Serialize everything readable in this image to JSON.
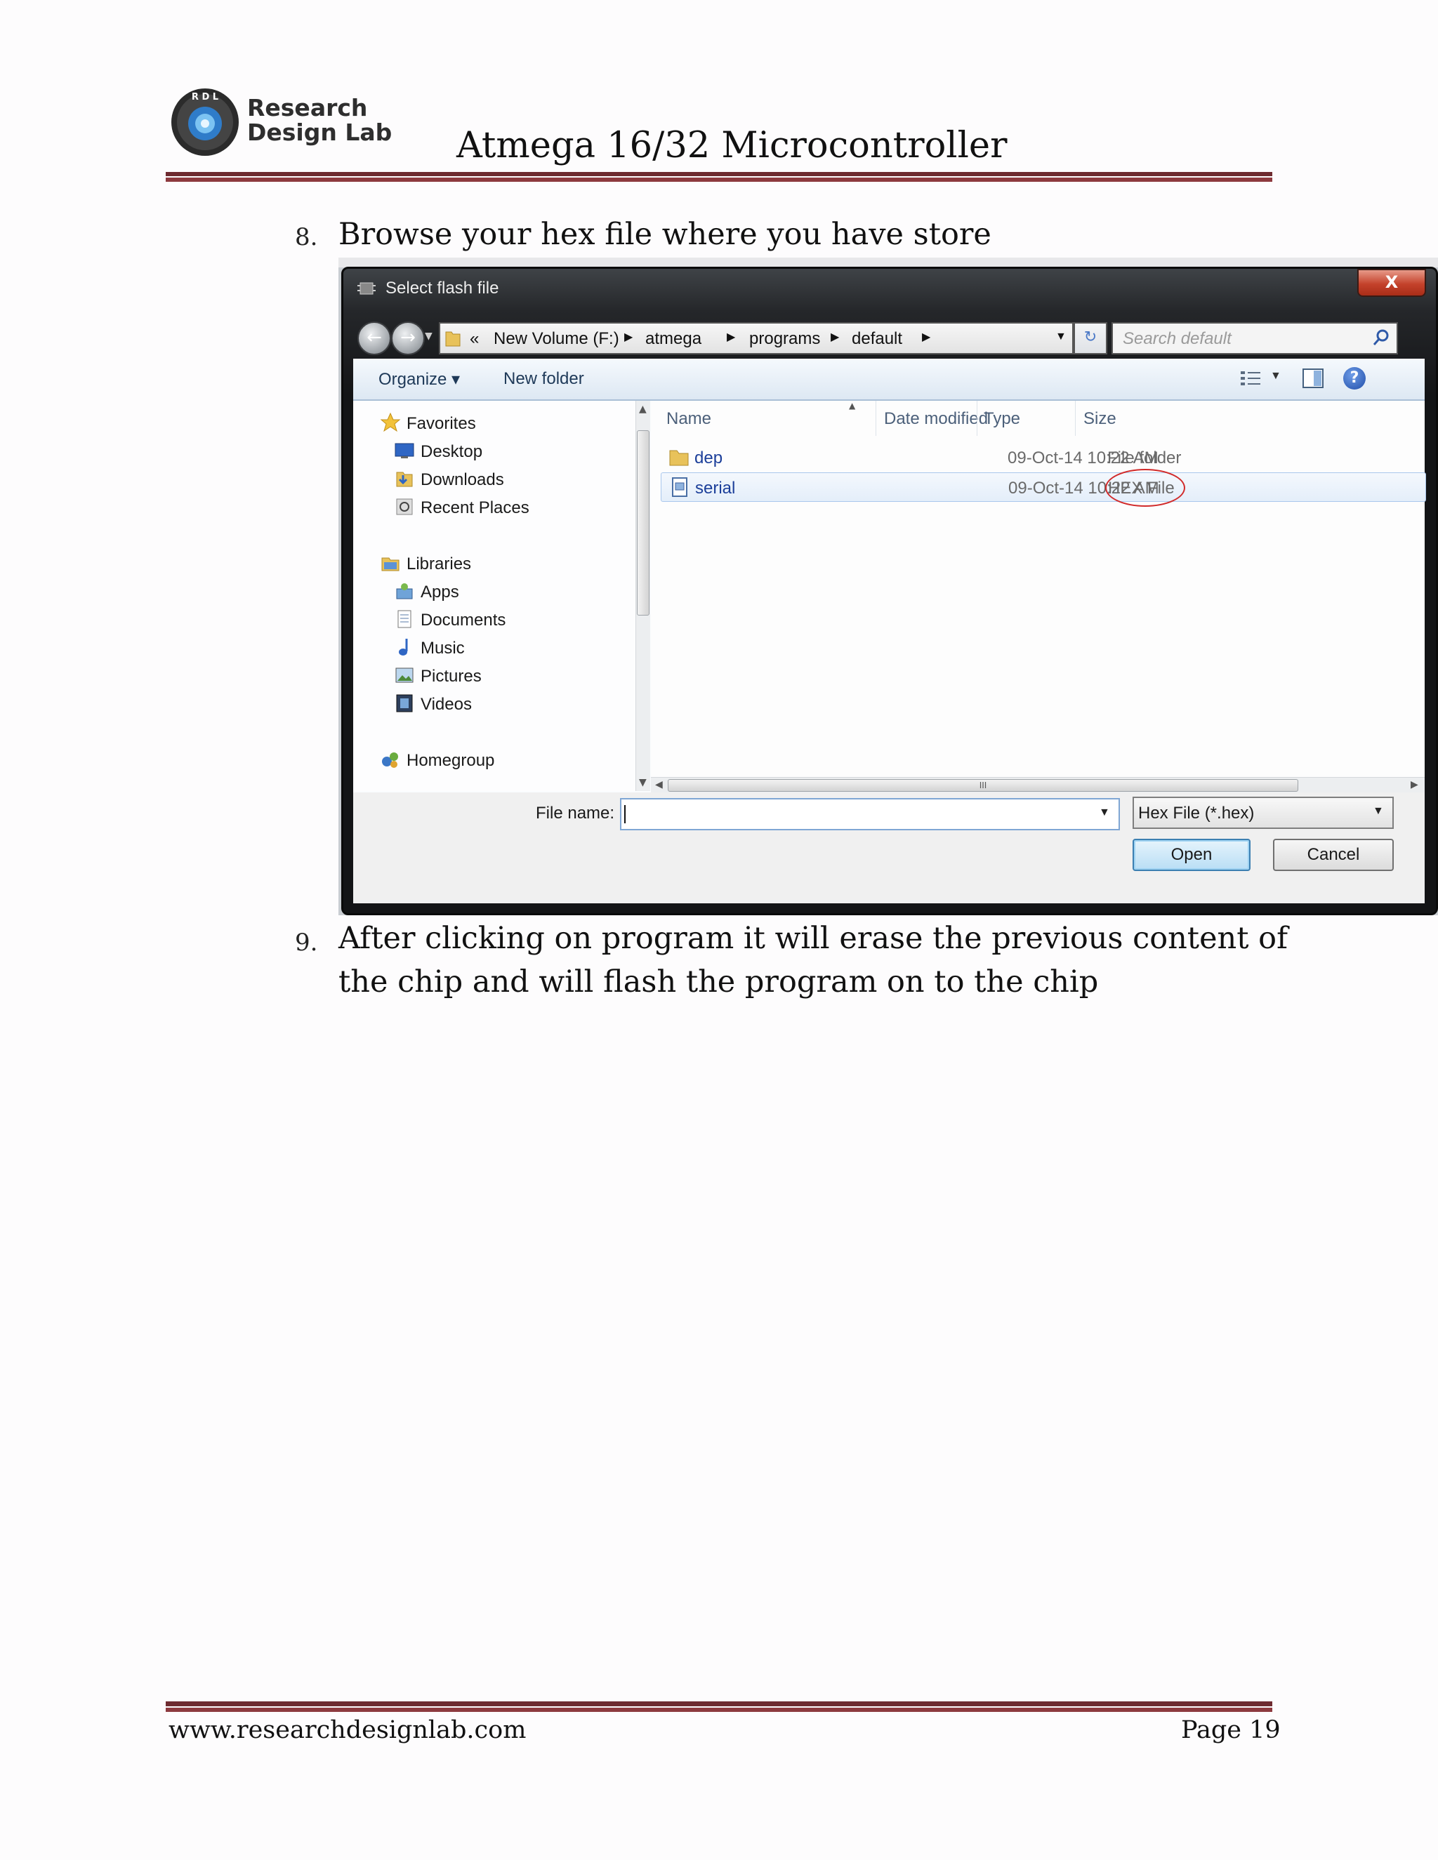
{
  "header": {
    "logo_letters": "R D L",
    "brand_line1": "Research",
    "brand_line2": "Design Lab",
    "doc_title": "Atmega 16/32 Microcontroller"
  },
  "steps": [
    {
      "number": "8.",
      "text": "Browse your hex file where you have  store"
    },
    {
      "number": "9.",
      "text": "After clicking on program it will erase the previous content of the chip and will flash the program on to the chip"
    }
  ],
  "dialog": {
    "title": "Select flash file",
    "close_label": "X",
    "address": {
      "overflow": "«",
      "crumbs": [
        "New Volume (F:)",
        "atmega",
        "programs",
        "default"
      ]
    },
    "search_placeholder": "Search default",
    "toolbar": {
      "organize": "Organize",
      "new_folder": "New folder"
    },
    "nav": {
      "favorites": {
        "label": "Favorites",
        "items": [
          "Desktop",
          "Downloads",
          "Recent Places"
        ]
      },
      "libraries": {
        "label": "Libraries",
        "items": [
          "Apps",
          "Documents",
          "Music",
          "Pictures",
          "Videos"
        ]
      },
      "homegroup": "Homegroup"
    },
    "columns": [
      "Name",
      "Date modified",
      "Type",
      "Size"
    ],
    "files": [
      {
        "name": "dep",
        "date": "09-Oct-14 10:22 AM",
        "type": "File folder",
        "icon": "folder-icon"
      },
      {
        "name": "serial",
        "date": "09-Oct-14 10:22 AM",
        "type": "HEX File",
        "icon": "hex-file-icon",
        "highlighted": true
      }
    ],
    "hscroll_grip": "III",
    "file_name_label": "File name:",
    "file_name_value": "",
    "file_type": "Hex File (*.hex)",
    "open_label": "Open",
    "cancel_label": "Cancel"
  },
  "footer": {
    "url": "www.researchdesignlab.com",
    "page": "Page 19"
  },
  "colors": {
    "rule": "#6e2b30",
    "annotation_circle": "#d12a2a",
    "link_blue": "#1c3f9a"
  }
}
